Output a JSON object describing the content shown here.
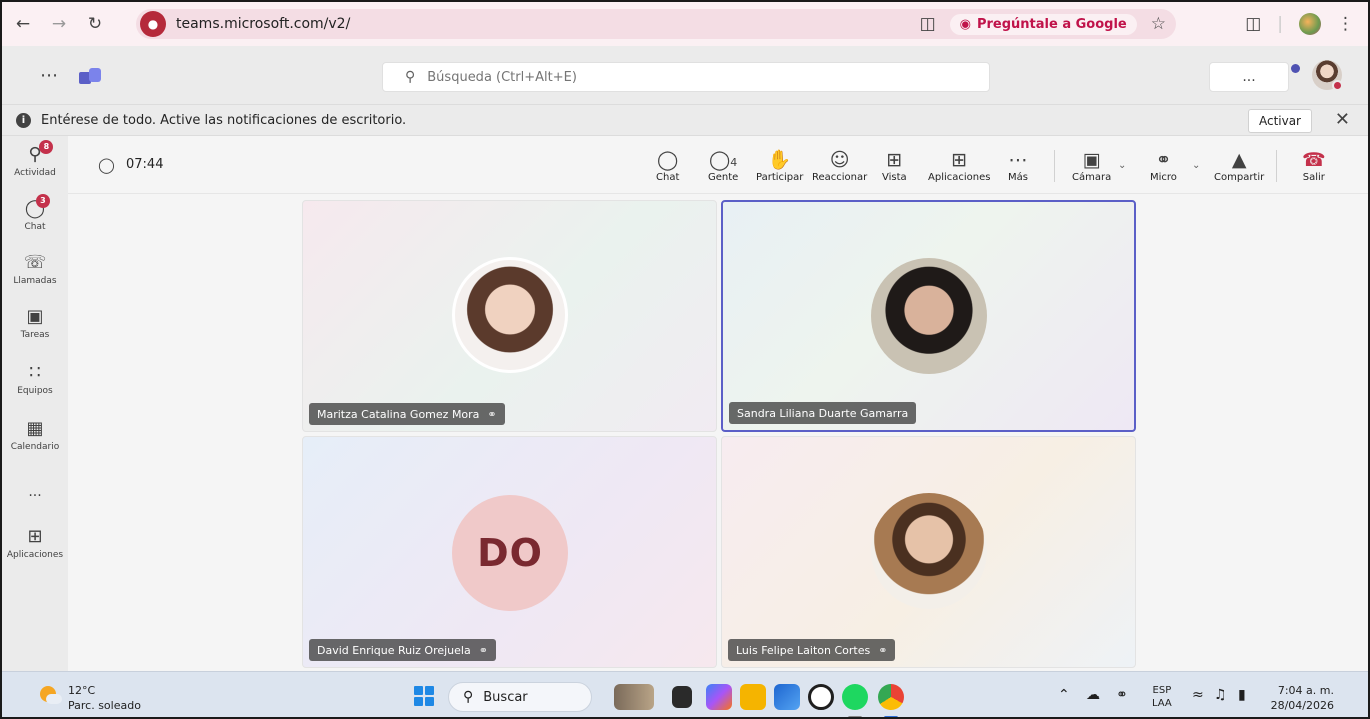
{
  "browser": {
    "url": "teams.microsoft.com/v2/",
    "ask_google": "Pregúntale a Google"
  },
  "header": {
    "search_placeholder": "Búsqueda (Ctrl+Alt+E)",
    "more": "..."
  },
  "notification": {
    "text": "Entérese de todo. Active las notificaciones de escritorio.",
    "activate": "Activar"
  },
  "rail": {
    "items": [
      {
        "label": "Actividad",
        "badge": "8"
      },
      {
        "label": "Chat",
        "badge": "3"
      },
      {
        "label": "Llamadas"
      },
      {
        "label": "Tareas"
      },
      {
        "label": "Equipos"
      },
      {
        "label": "Calendario"
      },
      {
        "label": "..."
      },
      {
        "label": "Aplicaciones"
      }
    ]
  },
  "meeting": {
    "timer": "07:44",
    "people_count": "4",
    "toolbar": {
      "chat": "Chat",
      "people": "Gente",
      "raise": "Participar",
      "react": "Reaccionar",
      "view": "Vista",
      "apps": "Aplicaciones",
      "more": "Más",
      "camera": "Cámara",
      "mic": "Micro",
      "share": "Compartir",
      "leave": "Salir"
    },
    "participants": [
      {
        "name": "Maritza Catalina Gomez Mora",
        "muted": true
      },
      {
        "name": "Sandra Liliana Duarte Gamarra",
        "muted": false,
        "active": true
      },
      {
        "name": "David Enrique Ruiz Orejuela",
        "initials": "DO",
        "muted": true
      },
      {
        "name": "Luis Felipe Laiton Cortes",
        "muted": true
      }
    ]
  },
  "taskbar": {
    "temp": "12°C",
    "condition": "Parc. soleado",
    "search": "Buscar",
    "lang_1": "ESP",
    "lang_2": "LAA",
    "time": "7:04 a. m.",
    "date": "28/04/2026"
  },
  "colors": {
    "accent": "#5b5fc7",
    "badge": "#c4314b",
    "initials_bg": "#f0c9c9"
  }
}
